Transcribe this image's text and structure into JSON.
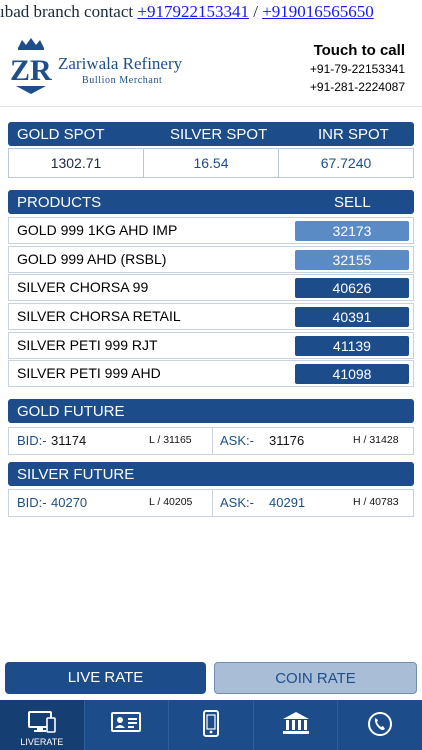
{
  "marquee": {
    "prefix": "ıbad branch contact ",
    "phone1": "+917922153341",
    "sep": " / ",
    "phone2": "+919016565650"
  },
  "header": {
    "brand": "Zariwala Refinery",
    "tagline": "Bullion Merchant",
    "touch": "Touch to call",
    "phone1": "+91-79-22153341",
    "phone2": "+91-281-2224087"
  },
  "spot": {
    "headers": [
      "GOLD SPOT",
      "SILVER SPOT",
      "INR SPOT"
    ],
    "values": [
      "1302.71",
      "16.54",
      "67.7240"
    ]
  },
  "products": {
    "header_name": "PRODUCTS",
    "header_sell": "SELL",
    "rows": [
      {
        "name": "GOLD 999 1KG AHD IMP",
        "sell": "32173"
      },
      {
        "name": "GOLD 999 AHD (RSBL)",
        "sell": "32155"
      },
      {
        "name": "SILVER CHORSA 99",
        "sell": "40626"
      },
      {
        "name": "SILVER CHORSA RETAIL",
        "sell": "40391"
      },
      {
        "name": "SILVER PETI 999 RJT",
        "sell": "41139"
      },
      {
        "name": "SILVER PETI 999 AHD",
        "sell": "41098"
      }
    ]
  },
  "gold_future": {
    "title": "GOLD FUTURE",
    "bid_label": "BID:-",
    "bid": "31174",
    "low": "L / 31165",
    "ask_label": "ASK:-",
    "ask": "31176",
    "high": "H / 31428"
  },
  "silver_future": {
    "title": "SILVER FUTURE",
    "bid_label": "BID:-",
    "bid": "40270",
    "low": "L / 40205",
    "ask_label": "ASK:-",
    "ask": "40291",
    "high": "H / 40783"
  },
  "buttons": {
    "live": "LIVE RATE",
    "coin": "COIN RATE"
  },
  "tabs": [
    {
      "icon": "liverate-monitor-icon",
      "label": "LIVERATE"
    },
    {
      "icon": "contact-card-icon",
      "label": ""
    },
    {
      "icon": "mobile-phone-icon",
      "label": ""
    },
    {
      "icon": "bank-icon",
      "label": ""
    },
    {
      "icon": "phone-call-icon",
      "label": ""
    }
  ],
  "colors": {
    "primary": "#1c4d8a",
    "sell_light": "#5b8bc5",
    "coin_button": "#a9bed6",
    "link": "#1a1aee"
  }
}
